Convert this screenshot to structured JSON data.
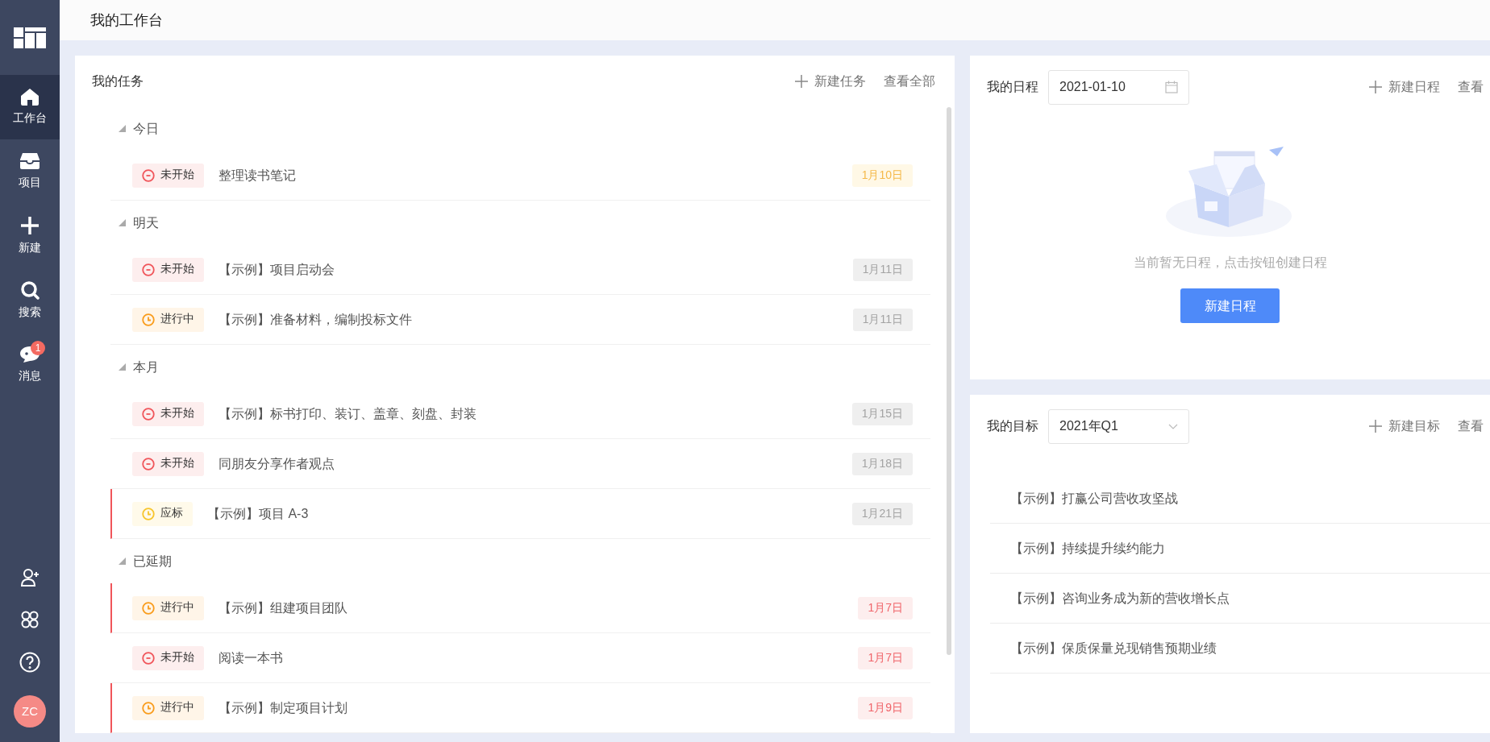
{
  "header": {
    "title": "我的工作台"
  },
  "sidebar": {
    "items": [
      {
        "label": "工作台",
        "selected": true
      },
      {
        "label": "项目",
        "selected": false
      },
      {
        "label": "新建",
        "selected": false
      },
      {
        "label": "搜索",
        "selected": false
      },
      {
        "label": "消息",
        "selected": false,
        "badge": "1"
      }
    ],
    "avatar": {
      "initials": "ZC"
    }
  },
  "tasks": {
    "title": "我的任务",
    "actions": [
      {
        "label": "新建任务",
        "kind": "add"
      },
      {
        "label": "查看全部",
        "kind": "link"
      }
    ],
    "groups": [
      {
        "label": "今日",
        "expanded": true,
        "tasks": [
          {
            "status": {
              "label": "未开始",
              "kind": "not_started"
            },
            "title": "整理读书笔记",
            "due": {
              "label": "1月10日",
              "kind": "today"
            },
            "flagged": false
          }
        ]
      },
      {
        "label": "明天",
        "expanded": true,
        "tasks": [
          {
            "status": {
              "label": "未开始",
              "kind": "not_started"
            },
            "title": "【示例】项目启动会",
            "due": {
              "label": "1月11日",
              "kind": "normal"
            },
            "flagged": false
          },
          {
            "status": {
              "label": "进行中",
              "kind": "in_progress"
            },
            "title": "【示例】准备材料，编制投标文件",
            "due": {
              "label": "1月11日",
              "kind": "normal"
            },
            "flagged": false
          }
        ]
      },
      {
        "label": "本月",
        "expanded": true,
        "tasks": [
          {
            "status": {
              "label": "未开始",
              "kind": "not_started"
            },
            "title": "【示例】标书打印、装订、盖章、刻盘、封装",
            "due": {
              "label": "1月15日",
              "kind": "normal"
            },
            "flagged": false
          },
          {
            "status": {
              "label": "未开始",
              "kind": "not_started"
            },
            "title": "同朋友分享作者观点",
            "due": {
              "label": "1月18日",
              "kind": "normal"
            },
            "flagged": false
          },
          {
            "status": {
              "label": "应标",
              "kind": "bid"
            },
            "title": "【示例】项目 A-3",
            "due": {
              "label": "1月21日",
              "kind": "normal"
            },
            "flagged": true
          }
        ]
      },
      {
        "label": "已延期",
        "expanded": true,
        "tasks": [
          {
            "status": {
              "label": "进行中",
              "kind": "in_progress"
            },
            "title": "【示例】组建项目团队",
            "due": {
              "label": "1月7日",
              "kind": "overdue"
            },
            "flagged": true
          },
          {
            "status": {
              "label": "未开始",
              "kind": "not_started"
            },
            "title": "阅读一本书",
            "due": {
              "label": "1月7日",
              "kind": "overdue"
            },
            "flagged": false
          },
          {
            "status": {
              "label": "进行中",
              "kind": "in_progress"
            },
            "title": "【示例】制定项目计划",
            "due": {
              "label": "1月9日",
              "kind": "overdue"
            },
            "flagged": true
          }
        ]
      }
    ]
  },
  "schedule": {
    "title": "我的日程",
    "date": "2021-01-10",
    "actions": [
      {
        "label": "新建日程",
        "kind": "add"
      },
      {
        "label": "查看",
        "kind": "link"
      }
    ],
    "empty": {
      "message": "当前暂无日程，点击按钮创建日程",
      "button": "新建日程"
    }
  },
  "goals": {
    "title": "我的目标",
    "period": "2021年Q1",
    "actions": [
      {
        "label": "新建目标",
        "kind": "add"
      },
      {
        "label": "查看",
        "kind": "link"
      }
    ],
    "items": [
      "【示例】打赢公司营收攻坚战",
      "【示例】持续提升续约能力",
      "【示例】咨询业务成为新的营收增长点",
      "【示例】保质保量兑现销售预期业绩"
    ]
  }
}
